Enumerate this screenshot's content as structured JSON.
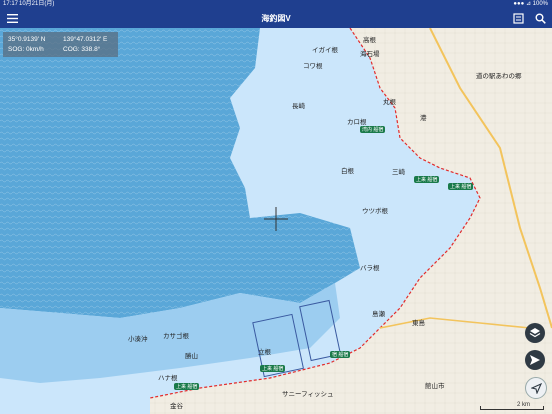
{
  "status_bar": {
    "time": "17:17",
    "date": "10月21日(月)",
    "right": "●●● ⊿ 100%"
  },
  "nav": {
    "title": "海釣図V"
  },
  "info_panel": {
    "lat": "35°0.9139' N",
    "lon": "139°47.0312' E",
    "sog": "SOG: 0km/h",
    "cog": "COG: 338.8°"
  },
  "map_labels": {
    "teranboura": "高根",
    "ikaiwa": "イガイ根",
    "kowa": "コワ根",
    "kaisekiba": "海石場",
    "maruzo": "丸根",
    "karone": "カロ根",
    "naneiwa": "長崎",
    "shirane": "白根",
    "utsubone": "ウツボ根",
    "misaki": "三崎",
    "barane": "バラ根",
    "kosaoki": "小湊沖",
    "tagasaki": "カサゴ根",
    "shimane": "島瀬",
    "higashi": "東島",
    "hasenohana": "ハナ根",
    "tatera": "立根",
    "katsuyama": "勝山",
    "kanaya": "金谷",
    "tateyama": "館山市",
    "minato": "港",
    "sanry": "サニーフィッシュ",
    "roadstation": "道の駅あわの郷"
  },
  "badges": [
    "湾内 船宿",
    "上来 船宿",
    "上来 船宿",
    "上来 船宿",
    "宿 船宿",
    "上来 船宿"
  ],
  "scale": {
    "label": "2 km"
  },
  "icons": {
    "menu": "menu-icon",
    "book": "chart-book-icon",
    "search": "search-icon",
    "layers": "layers-icon",
    "navigate": "send-icon",
    "locate": "locate-arrow-icon"
  },
  "colors": {
    "nav_bg": "#1f3f8f",
    "sea_deep": "#5aa7d8",
    "sea_shallow": "#dcefff",
    "land": "#f1ede3",
    "accent_red": "#e22b2b"
  }
}
